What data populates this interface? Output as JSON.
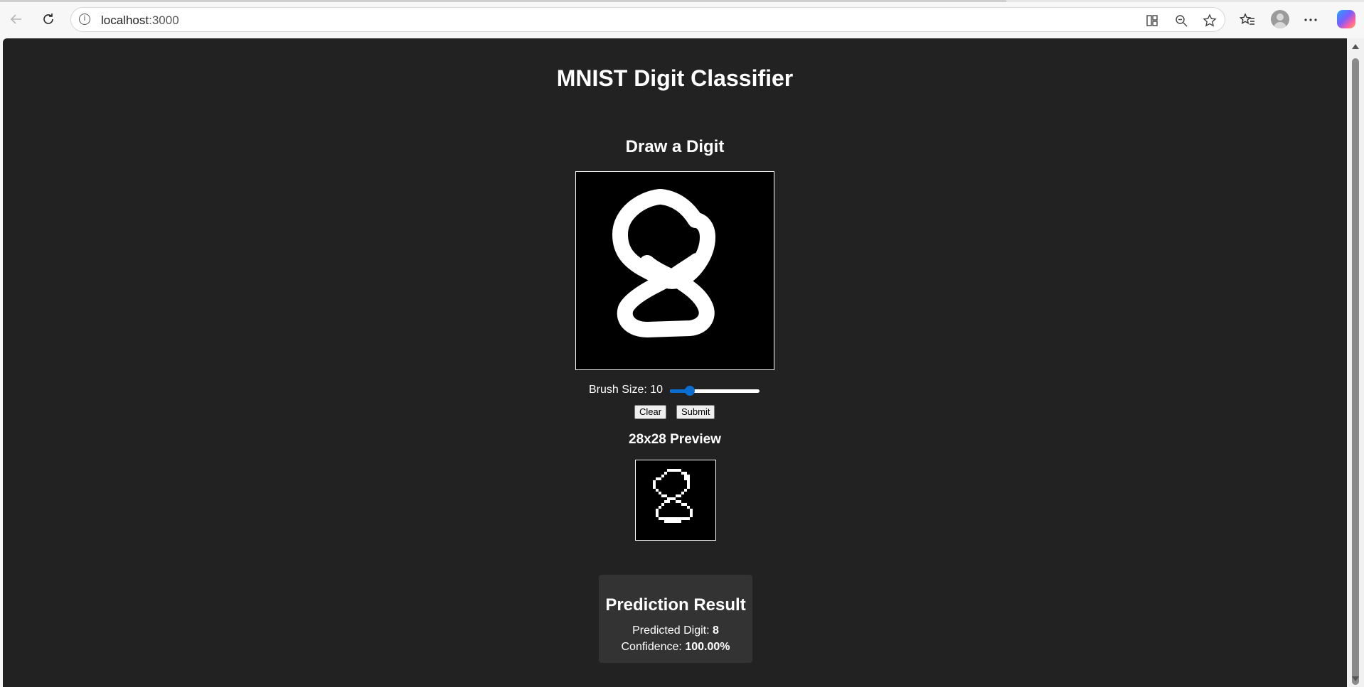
{
  "browser": {
    "url_host": "localhost",
    "url_port": ":3000",
    "icons": {
      "back": "back-arrow-icon",
      "reload": "reload-icon",
      "site_info": "info-icon",
      "app_available": "apps-icon",
      "zoom": "zoom-out-icon",
      "favorite": "star-icon",
      "favorites_bar": "favorites-icon",
      "profile": "profile-avatar",
      "more": "more-icon",
      "copilot": "copilot-icon"
    }
  },
  "page": {
    "title": "MNIST Digit Classifier",
    "draw_heading": "Draw a Digit",
    "brush": {
      "label": "Brush Size: 10",
      "value": 10,
      "min": 1,
      "max": 50
    },
    "buttons": {
      "clear": "Clear",
      "submit": "Submit"
    },
    "preview_heading": "28x28 Preview",
    "result": {
      "heading": "Prediction Result",
      "digit_label": "Predicted Digit: ",
      "digit_value": "8",
      "confidence_label": "Confidence: ",
      "confidence_value": "100.00%"
    }
  },
  "colors": {
    "page_bg": "#222222",
    "card_bg": "#333333",
    "accent": "#0a6ed1",
    "ink": "#ffffff"
  }
}
